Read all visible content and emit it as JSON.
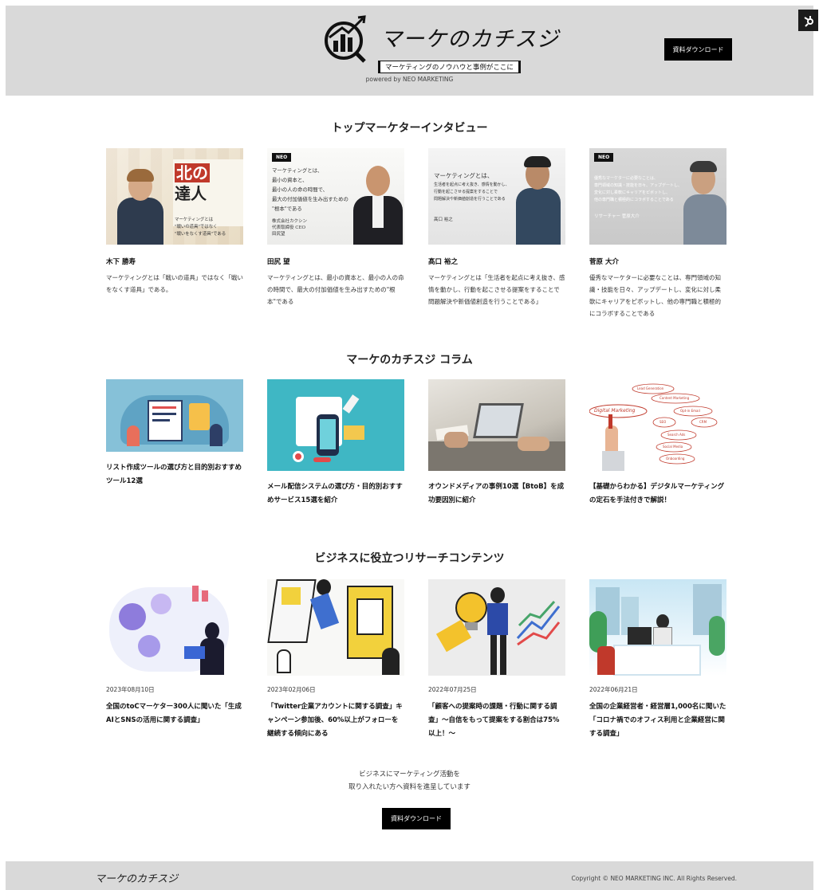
{
  "header": {
    "logo_text": "マーケのカチスジ",
    "logo_tagline": "マーケティングのノウハウと事例がここに",
    "powered_by": "powered by NEO MARKETING",
    "download_button": "資料ダウンロード",
    "badge_icon": "hubspot-icon"
  },
  "interview_section": {
    "title": "トップマーケターインタビュー",
    "cards": [
      {
        "name": "木下 勝寿",
        "desc": "マーケティングとは「戦いの道具」ではなく「戦いをなくす道具」である。",
        "image_text": [
          "北の",
          "達人",
          "マーケティングとは",
          "\"戦いの道具\"ではなく",
          "\"戦いをなくす道具\"である"
        ]
      },
      {
        "name": "田尻 望",
        "desc": "マーケティングとは、最小の資本と、最小の人の命の時間で、最大の付加価値を生み出すための\"根本\"である",
        "image_badge": "NEO",
        "image_text": [
          "マーケティングとは、",
          "最小の資本と、",
          "最小の人の命の時間で、",
          "最大の付加価値を生み出すための",
          "\"根本\"である",
          "株式会社カクシン",
          "代表取締役 CEO",
          "田尻望"
        ]
      },
      {
        "name": "髙口 裕之",
        "desc": "マーケティングとは「生活者を起点に考え抜き、感情を動かし、行動を起こさせる提案をすることで問題解決や新価値創造を行うことである」",
        "image_text": [
          "マーケティングとは、",
          "生活者を起点に考え抜き、感情を動かし、",
          "行動を起こさせる提案をすることで",
          "問題解決や新価値創造を行うことである",
          "髙口 裕之"
        ]
      },
      {
        "name": "菅原 大介",
        "desc": "優秀なマーケターに必要なことは、専門領域の知識・技能を日々、アップデートし、変化に対し柔軟にキャリアをピボットし、他の専門職と積極的にコラボすることである",
        "image_badge": "NEO",
        "image_text": [
          "優秀なマーケターに必要なことは、",
          "専門領域の知識・技能を日々、アップデートし、",
          "変化に対し柔軟にキャリアをピボットし、",
          "他の専門職と積極的にコラボすることである",
          "リサーチャー 菅原大介"
        ]
      }
    ]
  },
  "column_section": {
    "title": "マーケのカチスジ コラム",
    "cards": [
      {
        "title": "リスト作成ツールの選び方と目的別おすすめツール12選"
      },
      {
        "title": "メール配信システムの選び方・目的別おすすめサービス15選を紹介"
      },
      {
        "title": "オウンドメディアの事例10選【BtoB】を成功要因別に紹介"
      },
      {
        "title": "【基礎からわかる】デジタルマーケティングの定石を手法付きで解説！",
        "image_text": [
          "Lead Generation",
          "Content Marketing",
          "Digital Marketing",
          "Opt-in Email",
          "SEO",
          "CRM",
          "Search Ads",
          "Social Media",
          "Onboarding"
        ]
      }
    ]
  },
  "research_section": {
    "title": "ビジネスに役立つリサーチコンテンツ",
    "cards": [
      {
        "date": "2023年08月10日",
        "title": "全国のtoCマーケター300人に聞いた「生成AIとSNSの活用に関する調査」"
      },
      {
        "date": "2023年02月06日",
        "title": "「Twitter企業アカウントに関する調査」キャンペーン参加後、60%以上がフォローを継続する傾向にある"
      },
      {
        "date": "2022年07月25日",
        "title": "「顧客への提案時の課題・行動に関する調査」～自信をもって提案をする割合は75%以上！～"
      },
      {
        "date": "2022年06月21日",
        "title": "全国の企業経営者・経営層1,000名に聞いた「コロナ禍でのオフィス利用と企業経営に関する調査」"
      }
    ]
  },
  "cta": {
    "line1": "ビジネスにマーケティング活動を",
    "line2": "取り入れたい方へ資料を進呈しています",
    "button": "資料ダウンロード"
  },
  "footer": {
    "logo_text": "マーケのカチスジ",
    "copyright": "Copyright © NEO MARKETING INC. All Rights Reserved."
  }
}
